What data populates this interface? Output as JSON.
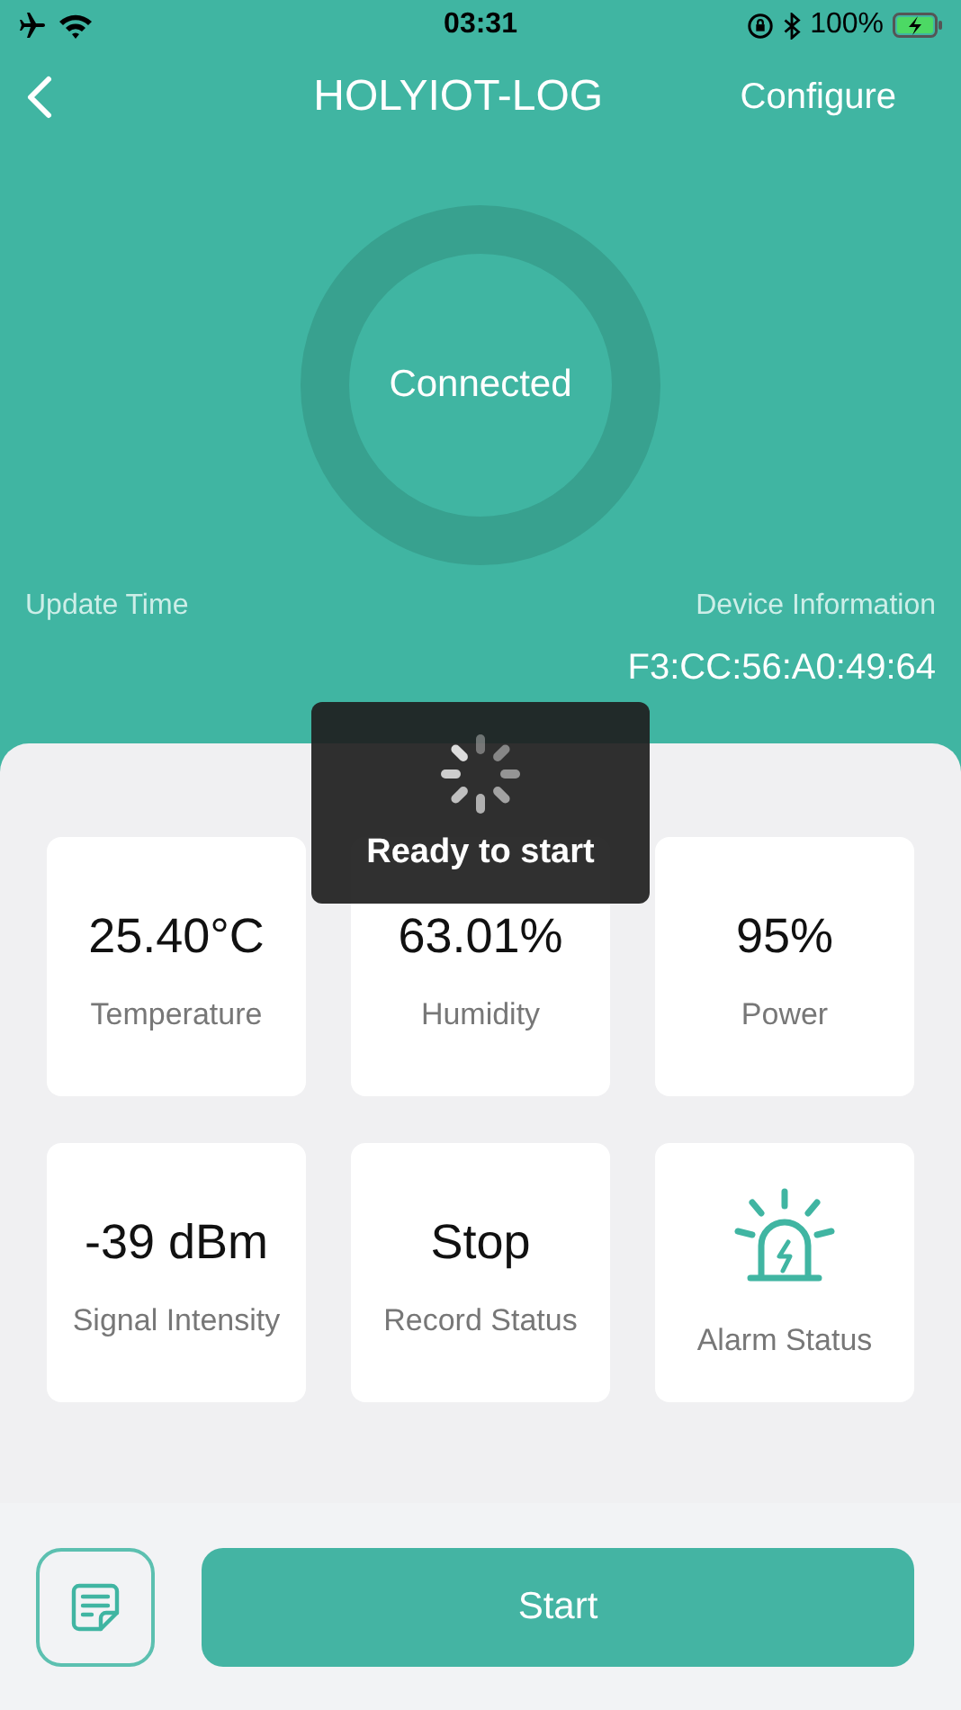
{
  "status_bar": {
    "time": "03:31",
    "battery": "100%"
  },
  "nav": {
    "title": "HOLYIOT-LOG",
    "action": "Configure"
  },
  "connection": {
    "status": "Connected"
  },
  "info": {
    "update_label": "Update Time",
    "device_label": "Device Information",
    "mac": "F3:CC:56:A0:49:64"
  },
  "tiles": [
    {
      "kind": "value",
      "value": "25.40°C",
      "label": "Temperature"
    },
    {
      "kind": "value",
      "value": "63.01%",
      "label": "Humidity"
    },
    {
      "kind": "value",
      "value": "95%",
      "label": "Power"
    },
    {
      "kind": "value",
      "value": "-39 dBm",
      "label": "Signal Intensity"
    },
    {
      "kind": "value",
      "value": "Stop",
      "label": "Record Status"
    },
    {
      "kind": "icon",
      "label": "Alarm Status"
    }
  ],
  "toast": {
    "message": "Ready to start"
  },
  "bottom": {
    "start": "Start"
  }
}
